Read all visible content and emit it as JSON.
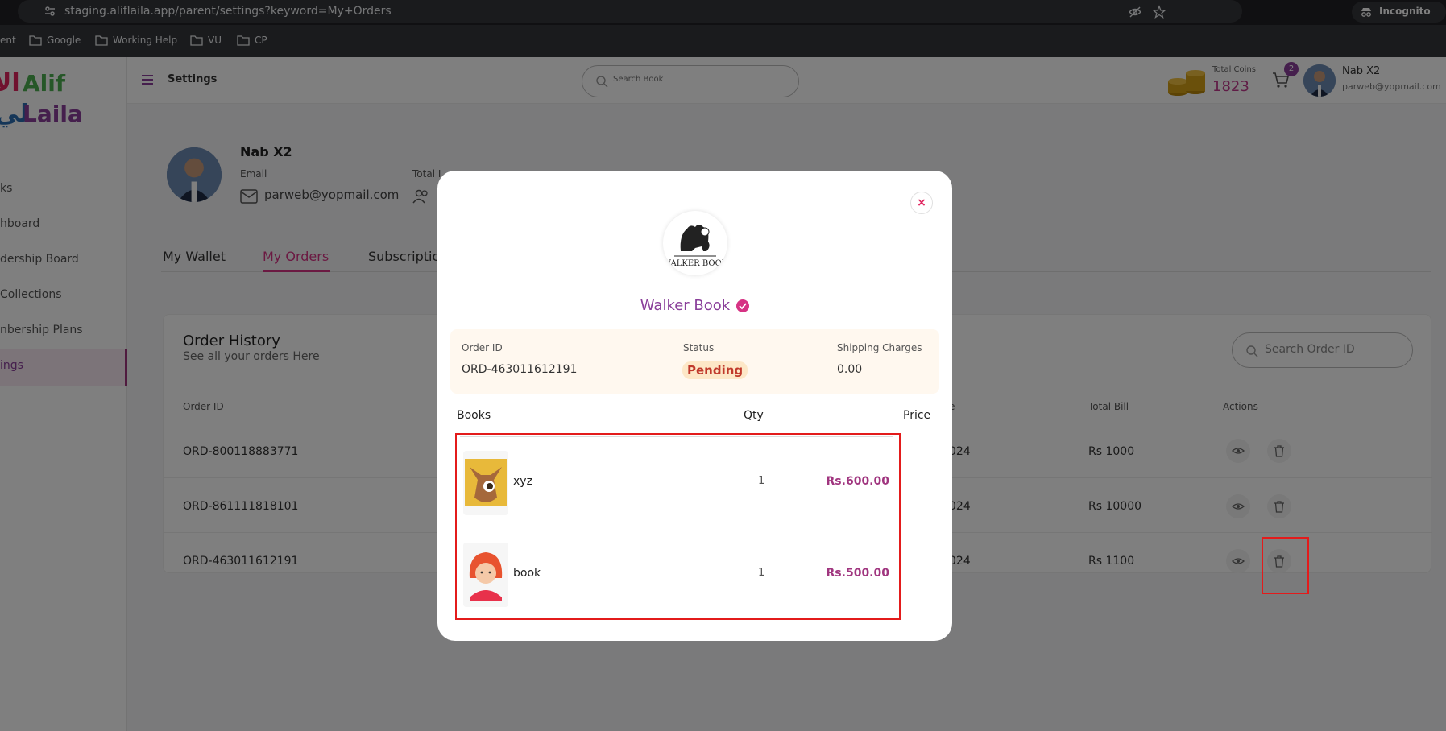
{
  "browser": {
    "url": "staging.aliflaila.app/parent/settings?keyword=My+Orders",
    "incognito_label": "Incognito",
    "bookmarks": [
      "ent",
      "Google",
      "Working Help",
      "VU",
      "CP"
    ]
  },
  "sidebar": {
    "brand": "Alif Laila",
    "items": [
      "ks",
      "hboard",
      "dership Board",
      "Collections",
      "nbership Plans",
      "ings"
    ],
    "active_index": 5
  },
  "topbar": {
    "page_title": "Settings",
    "search_placeholder": "Search Book",
    "coins_label": "Total Coins",
    "coins_value": "1823",
    "cart_count": "2",
    "user_name": "Nab X2",
    "user_email": "parweb@yopmail.com"
  },
  "profile": {
    "name": "Nab X2",
    "email_label": "Email",
    "email_value": "parweb@yopmail.com",
    "total_label": "Total I"
  },
  "tabs": [
    "My Wallet",
    "My Orders",
    "Subscriptio"
  ],
  "order_history": {
    "title": "Order History",
    "subtitle": "See all your orders Here",
    "search_placeholder": "Search Order ID",
    "columns": [
      "Order ID",
      "e",
      "Total Bill",
      "Actions"
    ],
    "rows": [
      {
        "id": "ORD-800118883771",
        "date": "024",
        "total": "Rs 1000"
      },
      {
        "id": "ORD-861111818101",
        "date": "024",
        "total": "Rs 10000"
      },
      {
        "id": "ORD-463011612191",
        "date": "024",
        "total": "Rs 1100"
      }
    ]
  },
  "modal": {
    "close_label": "×",
    "publisher_logo_text": "WALKER BOOK",
    "publisher_name": "Walker Book",
    "order_id_label": "Order ID",
    "order_id_value": "ORD-463011612191",
    "status_label": "Status",
    "status_value": "Pending",
    "shipping_label": "Shipping Charges",
    "shipping_value": "0.00",
    "col_books": "Books",
    "col_qty": "Qty",
    "col_price": "Price",
    "books": [
      {
        "title": "xyz",
        "qty": "1",
        "price": "Rs.600.00"
      },
      {
        "title": "book",
        "qty": "1",
        "price": "Rs.500.00"
      }
    ]
  },
  "colors": {
    "accent": "#d63384",
    "brand_purple": "#8a3f9a",
    "highlight_red": "#e31b1b",
    "overlay": "rgba(0,0,0,0.5)"
  }
}
